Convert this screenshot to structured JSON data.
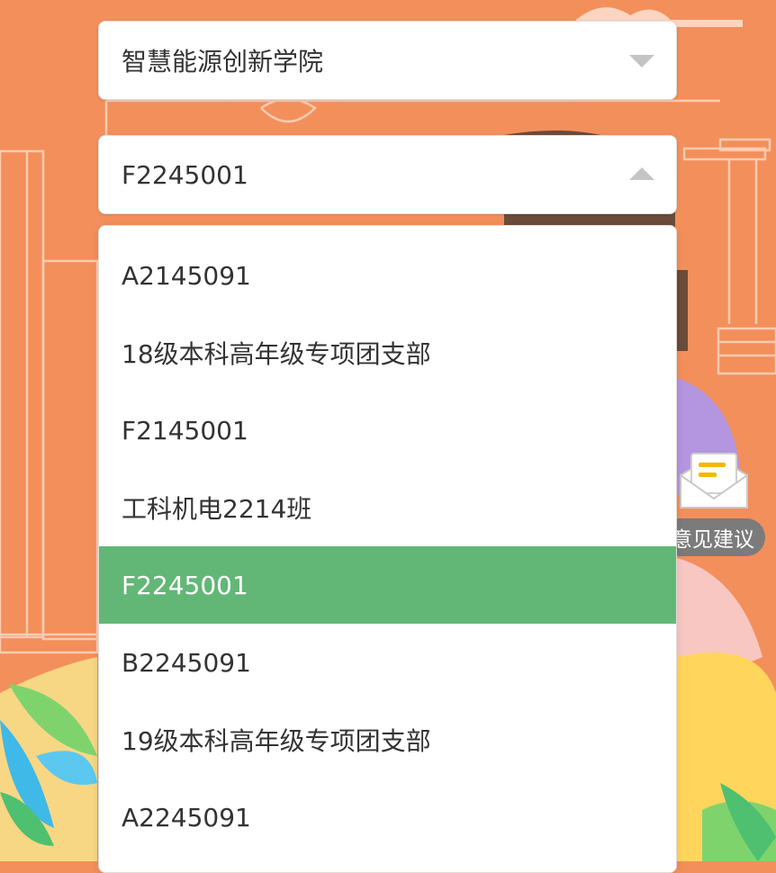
{
  "college_select": {
    "value": "智慧能源创新学院"
  },
  "class_select": {
    "value": "F2245001"
  },
  "dropdown": {
    "options": [
      "A2145091",
      "18级本科高年级专项团支部",
      "F2145001",
      "工科机电2214班",
      "F2245001",
      "B2245091",
      "19级本科高年级专项团支部",
      "A2245091"
    ],
    "selected_index": 4
  },
  "feedback": {
    "label": "意见建议"
  },
  "colors": {
    "background": "#f38f5b",
    "selected": "#62b777"
  }
}
